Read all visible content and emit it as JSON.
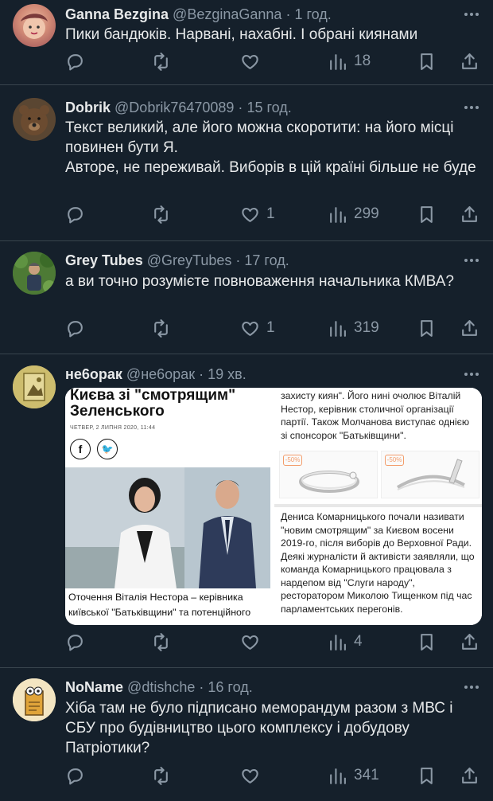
{
  "tweets": [
    {
      "name": "Ganna Bezgina",
      "handle": "@BezginaGanna",
      "sep": "·",
      "time": "1 год.",
      "text": "Пики бандюків. Нарвані, нахабні. І обрані киянами",
      "replies": "",
      "retweets": "",
      "likes": "",
      "views": "18"
    },
    {
      "name": "Dobrik",
      "handle": "@Dobrik76470089",
      "sep": "·",
      "time": "15 год.",
      "text": "Текст великий, але його можна скоротити: на його місці повинен бути Я.\nАвторе, не переживай. Виборів в цій країні більше не буде",
      "replies": "",
      "retweets": "",
      "likes": "1",
      "views": "299"
    },
    {
      "name": "Grey Tubes",
      "handle": "@GreyTubes",
      "sep": "·",
      "time": "17 год.",
      "text": "а ви точно розумієте повноваження начальника КМВА?",
      "replies": "",
      "retweets": "",
      "likes": "1",
      "views": "319"
    },
    {
      "name": "не6орак",
      "handle": "@не6орак",
      "sep": "·",
      "time": "19 хв.",
      "text": "",
      "replies": "",
      "retweets": "",
      "likes": "",
      "views": "4"
    },
    {
      "name": "NoName",
      "handle": "@dtishche",
      "sep": "·",
      "time": "16 год.",
      "text": "Хіба там не було підписано меморандум разом з МВС і СБУ про будівництво цього комплексу і добудову Патріотики?",
      "replies": "",
      "retweets": "",
      "likes": "",
      "views": "341"
    }
  ],
  "media": {
    "left_title": "Києва зі \"смотрящим\" Зеленського",
    "left_date": "ЧЕТВЕР, 2 ЛИПНЯ 2020, 11:44",
    "facebook_glyph": "f",
    "twitter_glyph": "🐦",
    "left_caption": "Оточення Віталія Нестора – керівника київської \"Батьківщини\" та потенційного",
    "right_top_text": "захисту киян\". Його нині очолює Віталій Нестор, керівник столичної організації партії. Також Молчанова виступає однією зі спонсорок \"Батьківщини\".",
    "discount_left": "-50%",
    "discount_right": "-50%",
    "right_bottom_text": "Дениса Комарницького почали називати \"новим смотрящим\" за Києвом восени 2019-го, після виборів до Верховної Ради. Деякі журналісти й активісти заявляли, що команда Комарницького працювала з нардепом від \"Слуги народу\", ресторатором Миколою Тищенком під час парламентських перегонів."
  },
  "colors": {
    "background": "#15202b",
    "text": "#e7e9ea",
    "muted": "#8b98a5",
    "divider": "#38444d"
  }
}
